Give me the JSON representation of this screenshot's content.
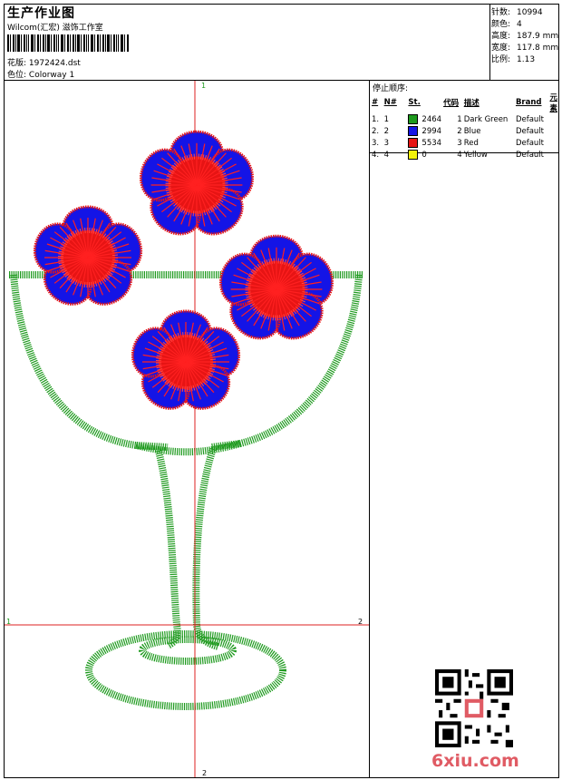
{
  "header": {
    "title": "生产作业图",
    "company": "Wilcom(汇宏) 滋饰工作室",
    "design_label": "花版:",
    "design_value": "1972424.dst",
    "colorway_label": "色位:",
    "colorway_value": "Colorway 1"
  },
  "stats": [
    {
      "label": "针数:",
      "value": "10994"
    },
    {
      "label": "颜色:",
      "value": "4"
    },
    {
      "label": "高度:",
      "value": "187.9 mm"
    },
    {
      "label": "宽度:",
      "value": "117.8 mm"
    },
    {
      "label": "比例:",
      "value": "1.13"
    }
  ],
  "stop_sequence": {
    "title": "停止顺序:",
    "columns": [
      "#",
      "N#",
      "St.",
      "代码",
      "描述",
      "Brand",
      "元素"
    ],
    "rows": [
      {
        "idx": "1.",
        "n": "1",
        "color": "#1e9a1e",
        "st": "2464",
        "code": "1",
        "desc": "Dark Green",
        "brand": "Default",
        "elem": ""
      },
      {
        "idx": "2.",
        "n": "2",
        "color": "#1414e6",
        "st": "2994",
        "code": "2",
        "desc": "Blue",
        "brand": "Default",
        "elem": ""
      },
      {
        "idx": "3.",
        "n": "3",
        "color": "#e61414",
        "st": "5534",
        "code": "3",
        "desc": "Red",
        "brand": "Default",
        "elem": ""
      },
      {
        "idx": "4.",
        "n": "4",
        "color": "#f2f20a",
        "st": "0",
        "code": "4",
        "desc": "Yellow",
        "brand": "Default",
        "elem": ""
      }
    ]
  },
  "axis_marks": {
    "top": "1",
    "bottom": "2",
    "left": "1",
    "right": "2"
  },
  "watermark": "6xiu.com",
  "colors": {
    "green": "#1e9a1e",
    "blue": "#1414e6",
    "red": "#e61414",
    "guide": "#dd2222"
  }
}
